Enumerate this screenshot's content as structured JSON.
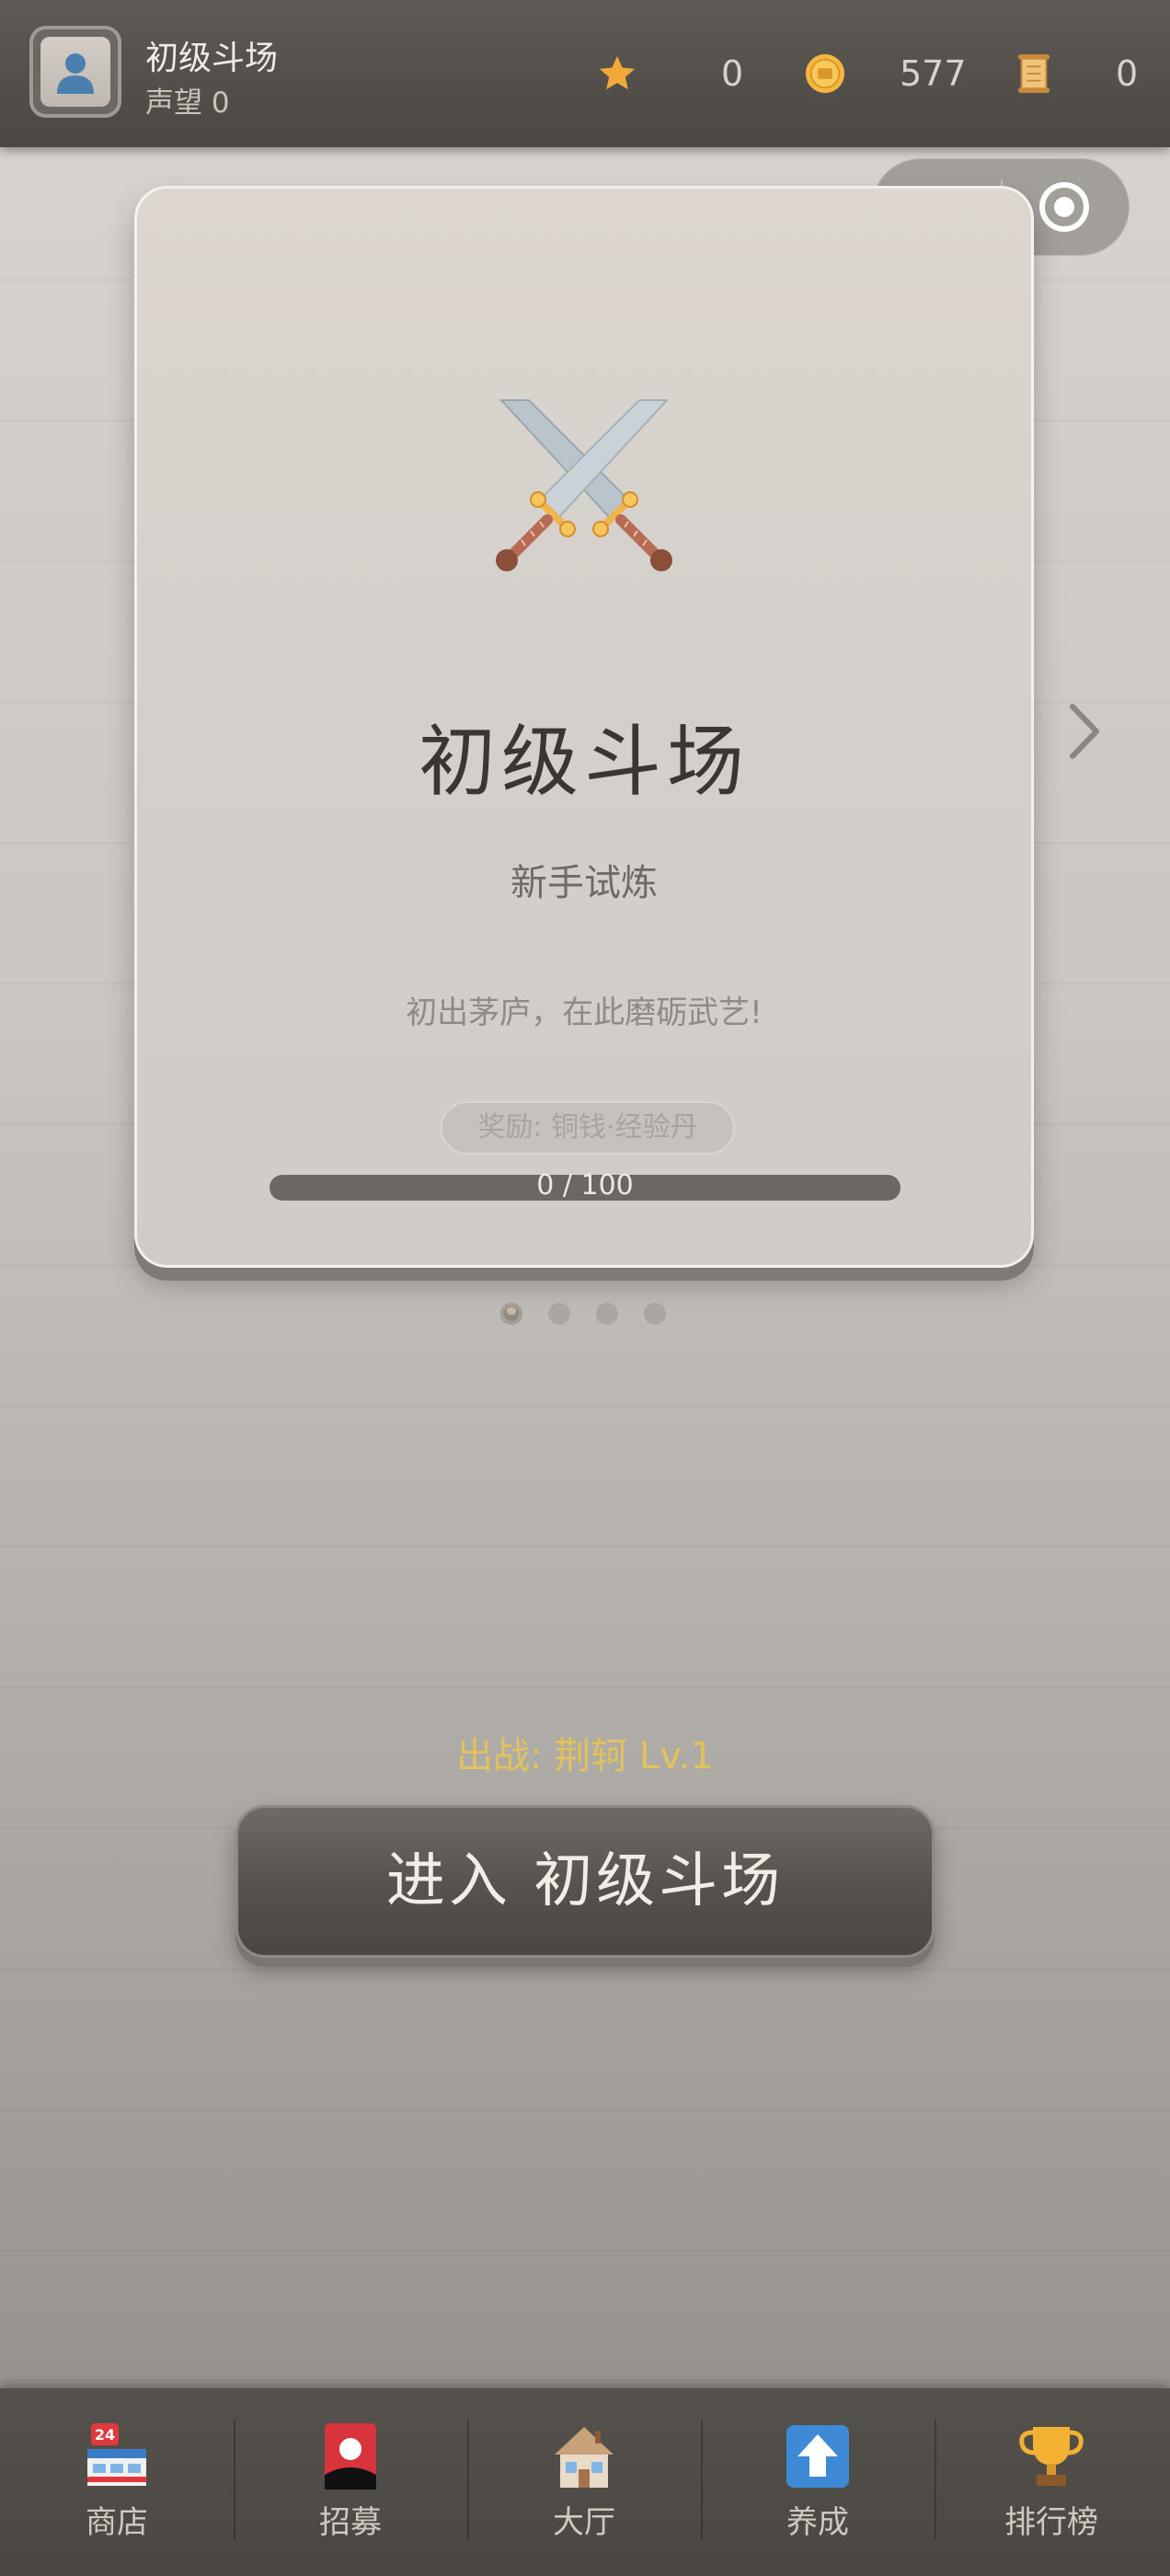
{
  "header": {
    "arena_name": "初级斗场",
    "reputation": "声望 0",
    "resources": {
      "stars": "0",
      "coins": "577",
      "scrolls": "0"
    }
  },
  "card": {
    "icon": "crossed-swords-icon",
    "title": "初级斗场",
    "subtitle": "新手试炼",
    "description": "初出茅庐，在此磨砺武艺!",
    "reward": "奖励: 铜钱·经验丹",
    "progress_text": "0 / 100",
    "progress_value": 0
  },
  "pagination": {
    "total": 4,
    "active": 0
  },
  "fighter": "出战: 荆轲 Lv.1",
  "enter_button": "进入 初级斗场",
  "nav": [
    {
      "label": "商店",
      "icon": "store-icon"
    },
    {
      "label": "招募",
      "icon": "recruit-card-icon"
    },
    {
      "label": "大厅",
      "icon": "hall-house-icon"
    },
    {
      "label": "养成",
      "icon": "upgrade-arrow-icon"
    },
    {
      "label": "排行榜",
      "icon": "trophy-icon"
    }
  ],
  "colors": {
    "accent_gold": "#e2c25a",
    "header_bg": "#4b4844",
    "button_bg": "#55514c"
  }
}
